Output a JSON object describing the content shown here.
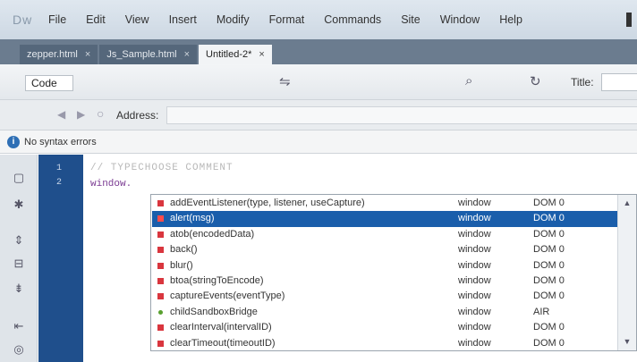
{
  "menu": {
    "items": [
      "File",
      "Edit",
      "View",
      "Insert",
      "Modify",
      "Format",
      "Commands",
      "Site",
      "Window",
      "Help"
    ]
  },
  "tabs": [
    {
      "label": "zepper.html",
      "close": "×",
      "active": false
    },
    {
      "label": "Js_Sample.html",
      "close": "×",
      "active": false
    },
    {
      "label": "Untitled-2*",
      "close": "×",
      "active": true
    }
  ],
  "toolbar": {
    "view_label": "Code",
    "title_label": "Title:"
  },
  "address_bar": {
    "label": "Address:"
  },
  "status": {
    "syntax_text": "No syntax errors"
  },
  "code": {
    "line_numbers": [
      "1",
      "2"
    ],
    "line1": "// TYPECHOOSE COMMENT",
    "line2": "window."
  },
  "hints": {
    "rows": [
      {
        "name": "addEventListener(type, listener, useCapture)",
        "object": "window",
        "version": "DOM 0",
        "marker": "red",
        "selected": false
      },
      {
        "name": "alert(msg)",
        "object": "window",
        "version": "DOM 0",
        "marker": "red",
        "selected": true
      },
      {
        "name": "atob(encodedData)",
        "object": "window",
        "version": "DOM 0",
        "marker": "red",
        "selected": false
      },
      {
        "name": "back()",
        "object": "window",
        "version": "DOM 0",
        "marker": "red",
        "selected": false
      },
      {
        "name": "blur()",
        "object": "window",
        "version": "DOM 0",
        "marker": "red",
        "selected": false
      },
      {
        "name": "btoa(stringToEncode)",
        "object": "window",
        "version": "DOM 0",
        "marker": "red",
        "selected": false
      },
      {
        "name": "captureEvents(eventType)",
        "object": "window",
        "version": "DOM 0",
        "marker": "red",
        "selected": false
      },
      {
        "name": "childSandboxBridge",
        "object": "window",
        "version": "AIR",
        "marker": "green",
        "selected": false
      },
      {
        "name": "clearInterval(intervalID)",
        "object": "window",
        "version": "DOM 0",
        "marker": "red",
        "selected": false
      },
      {
        "name": "clearTimeout(timeoutID)",
        "object": "window",
        "version": "DOM 0",
        "marker": "red",
        "selected": false
      }
    ]
  },
  "icons": {
    "app": "dw-logo-icon",
    "info": "info-icon",
    "refresh": "refresh-icon",
    "split": "split-view-icon",
    "inspect": "inspect-icon"
  },
  "colors": {
    "gutter": "#1f4f8c",
    "selection": "#1a5eab",
    "tab_bar": "#6b7c8f",
    "marker_red": "#d9363e",
    "marker_green": "#59a02f"
  }
}
